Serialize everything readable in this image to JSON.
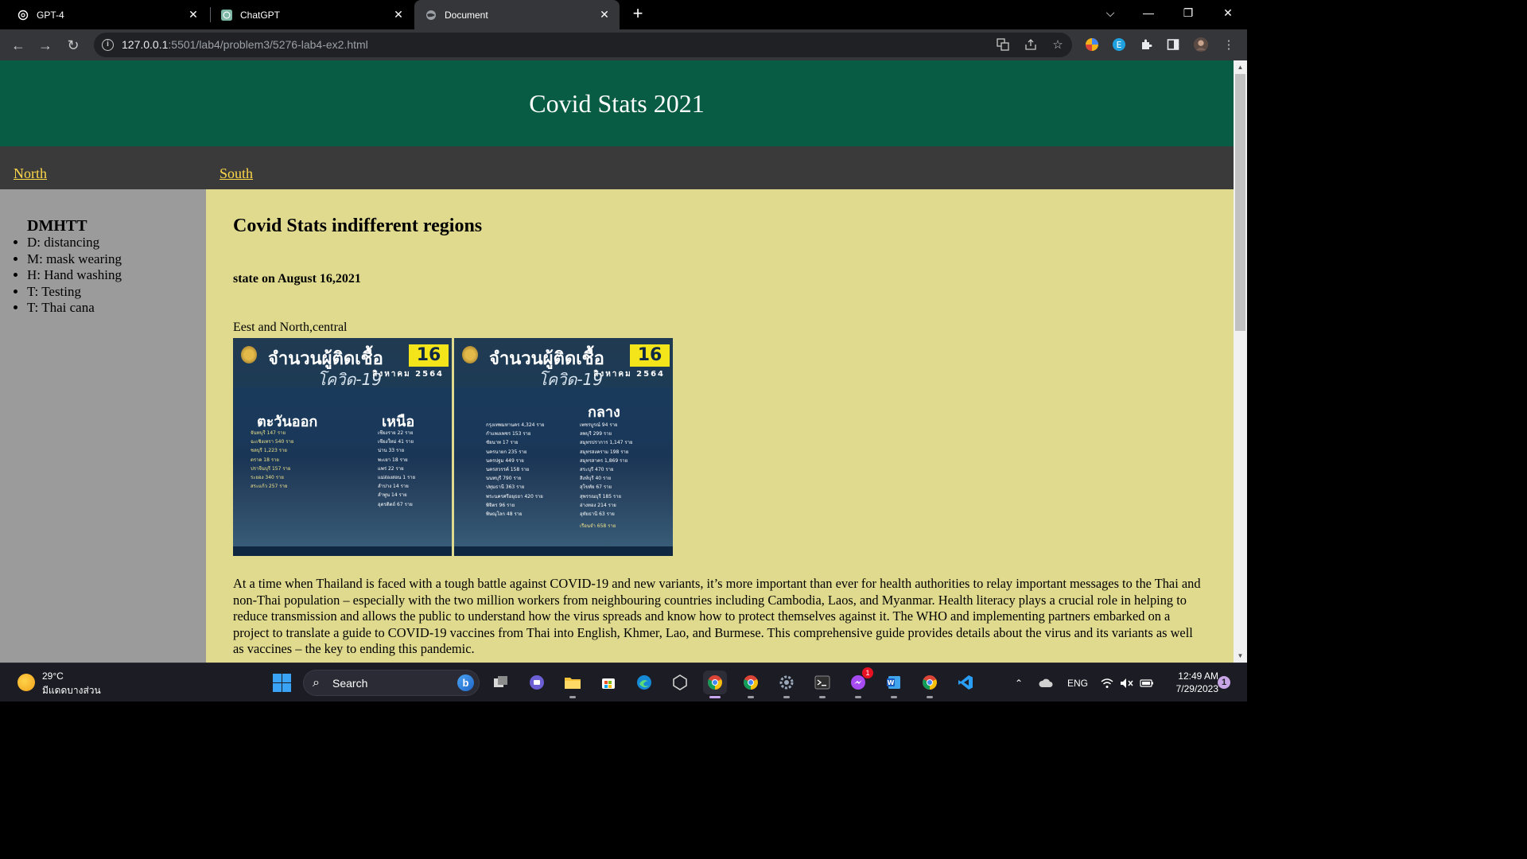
{
  "browser": {
    "tabs": [
      {
        "title": "GPT-4",
        "active": false
      },
      {
        "title": "ChatGPT",
        "active": false
      },
      {
        "title": "Document",
        "active": true
      }
    ],
    "url_host": "127.0.0.1",
    "url_rest": ":5501/lab4/problem3/5276-lab4-ex2.html"
  },
  "page": {
    "header_title": "Covid Stats 2021",
    "nav": [
      "North",
      "South"
    ],
    "sidebar": {
      "heading": "DMHTT",
      "items": [
        "D: distancing",
        "M: mask wearing",
        "H: Hand washing",
        "T: Testing",
        "T: Thai cana"
      ]
    },
    "main": {
      "heading": "Covid Stats indifferent regions",
      "subheading": "state on August 16,2021",
      "region_label": "Eest and North,central",
      "paragraph": "At a time when Thailand is faced with a tough battle against COVID-19 and new variants, it’s more important than ever for health authorities to relay important messages to the Thai and non-Thai population – especially with the two million workers from neighbouring countries including Cambodia, Laos, and Myanmar. Health literacy plays a crucial role in helping to reduce transmission and allows the public to understand how the virus spreads and know how to protect themselves against it. The WHO and implementing partners embarked on a project to translate a guide to COVID-19 vaccines from Thai into English, Khmer, Lao, and Burmese. This comprehensive guide provides details about the virus and its variants as well as vaccines – the key to ending this pandemic."
    },
    "posters": [
      {
        "title": "จำนวนผู้ติดเชื้อ",
        "subtitle": "โควิด-19",
        "day": "16",
        "month_year": "สิงหาคม 2564",
        "region_left": "ตะวันออก",
        "region_right": "เหนือ",
        "left_rows": [
          "จันทบุรี 147 ราย",
          "ฉะเชิงเทรา 540 ราย",
          "ชลบุรี 1,223 ราย",
          "ตราด 18 ราย",
          "ปราจีนบุรี 157 ราย",
          "ระยอง 340 ราย",
          "สระแก้ว 257 ราย"
        ],
        "right_rows": [
          "เชียงราย 22 ราย",
          "เชียงใหม่ 41 ราย",
          "น่าน 33 ราย",
          "พะเยา 18 ราย",
          "แพร่ 22 ราย",
          "แม่ฮ่องสอน 1 ราย",
          "ลำปาง 14 ราย",
          "ลำพูน 14 ราย",
          "อุตรดิตถ์ 67 ราย"
        ]
      },
      {
        "title": "จำนวนผู้ติดเชื้อ",
        "subtitle": "โควิด-19",
        "day": "16",
        "month_year": "สิงหาคม 2564",
        "region": "กลาง",
        "left_rows": [
          "กรุงเทพมหานคร 4,324 ราย",
          "กำแพงเพชร 153 ราย",
          "ชัยนาท 17 ราย",
          "นครนายก 235 ราย",
          "นครปฐม 449 ราย",
          "นครสวรรค์ 158 ราย",
          "นนทบุรี 790 ราย",
          "ปทุมธานี 363 ราย",
          "พระนครศรีอยุธยา 420 ราย",
          "พิจิตร 96 ราย",
          "พิษณุโลก 48 ราย"
        ],
        "right_rows": [
          "เพชรบูรณ์ 94 ราย",
          "ลพบุรี 299 ราย",
          "สมุทรปราการ 1,147 ราย",
          "สมุทรสงคราม 198 ราย",
          "สมุทรสาคร 1,869 ราย",
          "สระบุรี 470 ราย",
          "สิงห์บุรี 40 ราย",
          "สุโขทัย 67 ราย",
          "สุพรรณบุรี 185 ราย",
          "อ่างทอง 214 ราย",
          "อุทัยธานี 63 ราย",
          "เรือนจำ 658 ราย"
        ]
      }
    ]
  },
  "taskbar": {
    "weather_temp": "29°C",
    "weather_desc": "มีแดดบางส่วน",
    "search_label": "Search",
    "lang": "ENG",
    "time": "12:49 AM",
    "date": "7/29/2023",
    "notif_count": "1",
    "messenger_badge": "1"
  }
}
